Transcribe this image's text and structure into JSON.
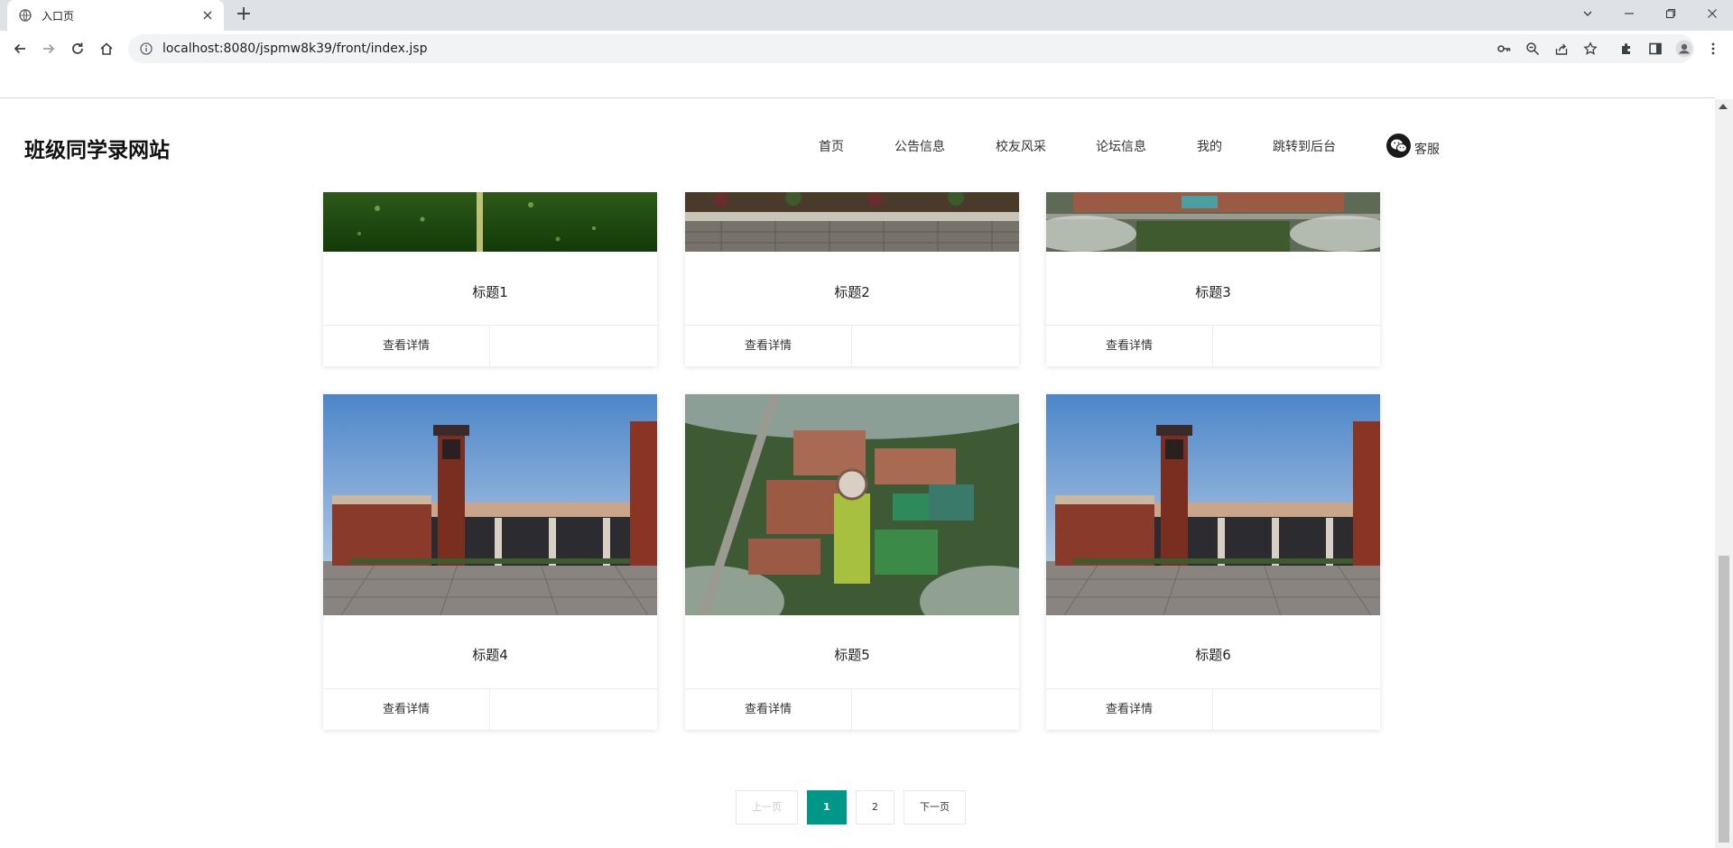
{
  "browser": {
    "tab_title": "入口页",
    "new_tab_icon": "plus-icon",
    "url": "localhost:8080/jspmw8k39/front/index.jsp"
  },
  "site": {
    "logo": "班级同学录网站",
    "nav": [
      "首页",
      "公告信息",
      "校友风采",
      "论坛信息",
      "我的",
      "跳转到后台"
    ],
    "service_label": "客服"
  },
  "cards": [
    {
      "title": "标题1",
      "detail": "查看详情",
      "image": "green-lawn-photo"
    },
    {
      "title": "标题2",
      "detail": "查看详情",
      "image": "stone-wall-garden-photo"
    },
    {
      "title": "标题3",
      "detail": "查看详情",
      "image": "campus-aerial-photo"
    },
    {
      "title": "标题4",
      "detail": "查看详情",
      "image": "school-building-clock-tower-photo"
    },
    {
      "title": "标题5",
      "detail": "查看详情",
      "image": "campus-aerial-rendering-photo"
    },
    {
      "title": "标题6",
      "detail": "查看详情",
      "image": "school-building-clock-tower-photo"
    }
  ],
  "pagination": {
    "prev": "上一页",
    "pages": [
      "1",
      "2"
    ],
    "current": "1",
    "next": "下一页"
  },
  "colors": {
    "accent": "#009688",
    "tabbar": "#dee1e6",
    "omnibox": "#f1f3f4"
  }
}
